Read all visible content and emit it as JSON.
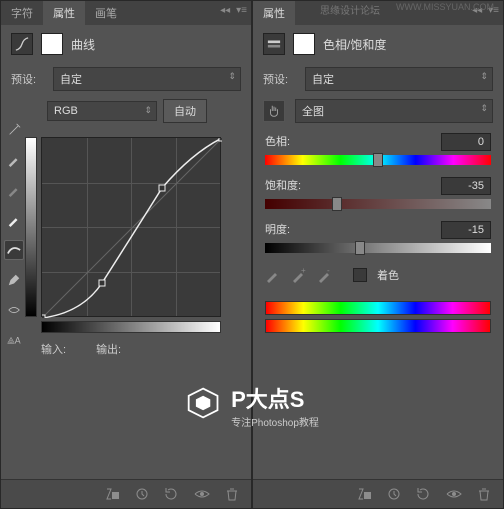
{
  "left_panel": {
    "tabs": [
      "字符",
      "属性",
      "画笔"
    ],
    "active_tab": "属性",
    "adjustment_name": "曲线",
    "preset_label": "预设:",
    "preset_value": "自定",
    "channel_value": "RGB",
    "auto_btn": "自动",
    "input_label": "输入:",
    "output_label": "输出:"
  },
  "right_panel": {
    "tabs": [
      "属性"
    ],
    "adjustment_name": "色相/饱和度",
    "preset_label": "预设:",
    "preset_value": "自定",
    "range_value": "全图",
    "hue_label": "色相:",
    "hue_value": "0",
    "sat_label": "饱和度:",
    "sat_value": "-35",
    "light_label": "明度:",
    "light_value": "-15",
    "colorize_label": "着色"
  },
  "watermark": {
    "top": "思缘设计论坛",
    "url": "WWW.MISSYUAN.COM",
    "brand": "P大点S",
    "sub": "专注Photoshop教程"
  }
}
